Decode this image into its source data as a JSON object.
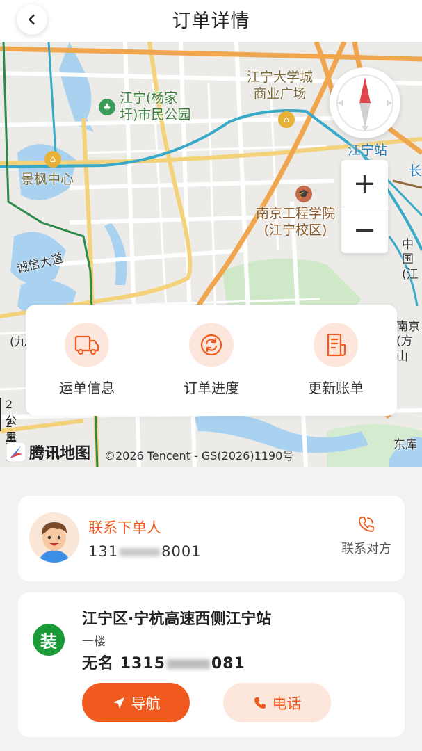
{
  "header": {
    "title": "订单详情"
  },
  "map": {
    "labels": {
      "jiangning_park": "江宁(杨家\n圩)市民公园",
      "university_plaza": "江宁大学城\n商业广场",
      "jingfeng_center": "景枫中心",
      "jiangning_station": "江宁站",
      "nanjing_engineering": "南京工程学院\n(江宁校区)",
      "chengxin_road": "诚信大道",
      "zhong_partial": "中国\n(江",
      "nanjing_partial": "南京\n(方山",
      "dongku_partial": "东库",
      "left_paren": "(九",
      "chang_partial": "长"
    },
    "scale": {
      "metric": "2 公里",
      "imperial": "2 英里"
    },
    "brand": "腾讯地图",
    "copyright": "©2026 Tencent - GS(2026)1190号",
    "zoom_in": "+",
    "zoom_out": "−"
  },
  "actions": [
    {
      "label": "运单信息",
      "icon": "truck-icon"
    },
    {
      "label": "订单进度",
      "icon": "refresh-icon"
    },
    {
      "label": "更新账单",
      "icon": "bill-icon"
    }
  ],
  "contact": {
    "title": "联系下单人",
    "phone_prefix": "131",
    "phone_suffix": "8001",
    "action_label": "联系对方"
  },
  "address": {
    "badge": "装",
    "title": "江宁区·宁杭高速西侧江宁站",
    "floor": "一楼",
    "contact_name": "无名",
    "contact_phone_prefix": "1315",
    "contact_phone_suffix": "081",
    "nav_button": "导航",
    "call_button": "电话"
  },
  "colors": {
    "accent": "#f15a1e",
    "accent_soft": "#fde7dc",
    "badge_green": "#1b9a38"
  }
}
